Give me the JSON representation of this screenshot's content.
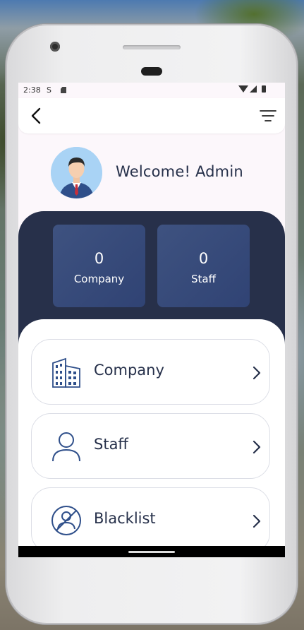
{
  "status_bar": {
    "time": "2:38",
    "s_icon": "S"
  },
  "app_bar": {
    "back_icon": "chevron-left-icon",
    "menu_icon": "filter-menu-icon"
  },
  "welcome": {
    "text": "Welcome! Admin",
    "avatar": "admin-avatar"
  },
  "stats": [
    {
      "value": "0",
      "label": "Company"
    },
    {
      "value": "0",
      "label": "Staff"
    }
  ],
  "menu": [
    {
      "label": "Company",
      "icon": "building-icon"
    },
    {
      "label": "Staff",
      "icon": "person-icon"
    },
    {
      "label": "Blacklist",
      "icon": "blocked-user-icon"
    }
  ],
  "colors": {
    "primary_dark": "#27304a",
    "stat_card": "#3e5280",
    "text_dark": "#26304a",
    "background": "#fcf7fb"
  }
}
